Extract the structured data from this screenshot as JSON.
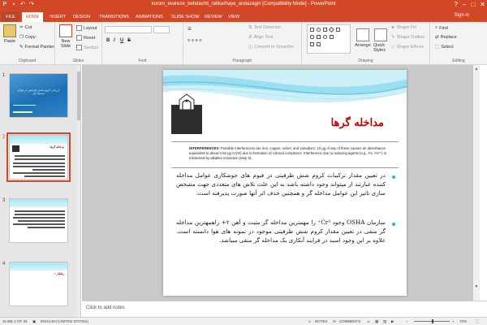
{
  "window": {
    "title": "korom_evareze_behdashti_rahkarhaye_andazegiri [Compatibility Mode] - PowerPoint",
    "sign_in": "Sign in"
  },
  "ribbon_tabs": [
    {
      "label": "FILE"
    },
    {
      "label": "HOME"
    },
    {
      "label": "INSERT"
    },
    {
      "label": "DESIGN"
    },
    {
      "label": "TRANSITIONS"
    },
    {
      "label": "ANIMATIONS"
    },
    {
      "label": "SLIDE SHOW"
    },
    {
      "label": "REVIEW"
    },
    {
      "label": "VIEW"
    }
  ],
  "clipboard": {
    "paste": "Paste",
    "cut": "Cut",
    "copy": "Copy",
    "format_painter": "Format Painter",
    "label": "Clipboard"
  },
  "slides_group": {
    "new_slide": "New Slide",
    "layout": "Layout",
    "reset": "Reset",
    "section": "Section",
    "label": "Slides"
  },
  "font_group": {
    "bold": "B",
    "italic": "I",
    "underline": "U",
    "strike": "S",
    "label": "Font"
  },
  "paragraph_group": {
    "text_direction": "Text Direction",
    "align_text": "Align Text",
    "convert_smartart": "Convert to SmartArt",
    "label": "Paragraph"
  },
  "drawing_group": {
    "arrange": "Arrange",
    "quick_styles": "Quick Styles",
    "shape_fill": "Shape Fill",
    "shape_outline": "Shape Outline",
    "shape_effects": "Shape Effects",
    "label": "Drawing"
  },
  "editing_group": {
    "find": "Find",
    "replace": "Replace",
    "select": "Select",
    "label": "Editing"
  },
  "thumbnails": [
    {
      "num": "1",
      "title": "ارزیابی کروم شش ظرفیتی در هوای محیط کار"
    },
    {
      "num": "2",
      "title": "مداخله گرها"
    },
    {
      "num": "3",
      "title": ""
    },
    {
      "num": "4",
      "title": "راهکار ۱"
    }
  ],
  "slide": {
    "title": "مداخله گرها",
    "interferences_label": "INTERFERENCES:",
    "interferences_text": " Possible interferences are iron, copper, nickel, and vanadium; 10 µg of any of these causes an absorbance equivalent to about 0.02 µg Cr(VI) due to formation of colored complexes. Interference due to reducing agents (e.g., Fe, Fe²⁺) is minimized by alkaline extraction (step 5).",
    "paragraph_1": "در تعیین مقدار ترکیبات کروم شش ظرفیتی در فیوم های جوشکاری عوامل مداخله کننده عبارتند از میتواند وجود داشته باشد به این علت تلاش های متعددی جهت مشخص سازی تاثیر این عوامل مداخله گر و همچنین حذف اثر آنها صورت پذیرفته است.",
    "paragraph_2": "سازمان OSHA وجود Cr³⁺ را مهمترین مداخله گر مثبت و آهن ۲+ راهمهترین مداخله گر منفی در تعیین مقدار کروم شش ظرفیتی موجود در نمونه های هوا دانسته است. علاوه بر این وجود اسید در فرایند آبکاری یک مداخله گر منفی میباشد."
  },
  "notes_placeholder": "Click to add notes",
  "status": {
    "slide_info": "SLIDE 2 OF 33",
    "language": "ENGLISH (UNITED STATES)",
    "notes": "NOTES",
    "comments": "COMMENTS",
    "zoom": "70%",
    "zoom_level": 0.7
  },
  "colors": {
    "accent": "#d24726",
    "title_red": "#c00000",
    "bullet_blue": "#2bb5d8"
  }
}
